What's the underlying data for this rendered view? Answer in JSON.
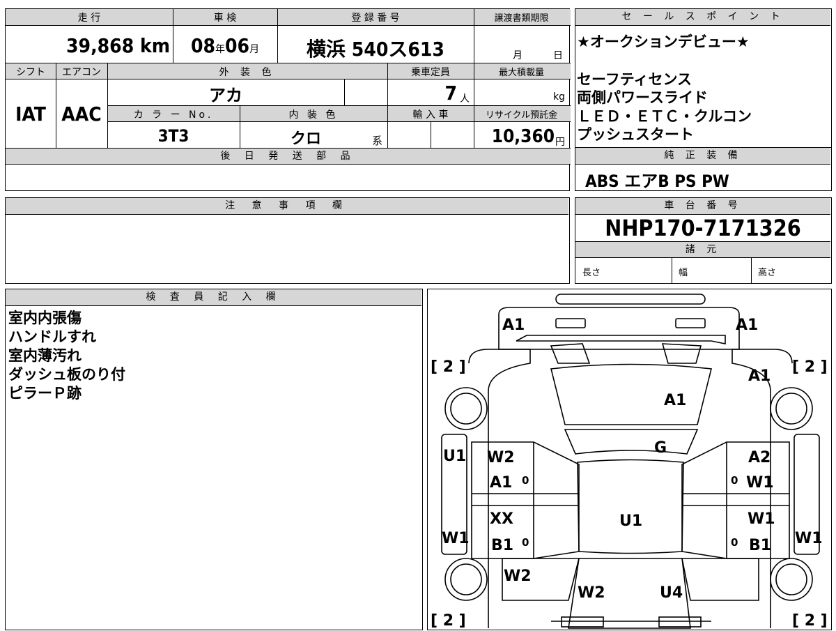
{
  "vehicle": {
    "mileage_label": "走 行",
    "mileage_value": "39,868",
    "mileage_unit": "km",
    "inspection_label": "車 検",
    "inspection_year": "08",
    "inspection_year_unit": "年",
    "inspection_month": "06",
    "inspection_month_unit": "月",
    "registration_label": "登 録 番 号",
    "registration_value": "横浜 540ス613",
    "transfer_deadline_label": "譲渡書類期限",
    "transfer_month_unit": "月",
    "transfer_day_unit": "日",
    "shift_label": "シフト",
    "shift_value": "IAT",
    "aircon_label": "エアコン",
    "aircon_value": "AAC",
    "exterior_color_label": "外 装 色",
    "exterior_color_value": "アカ",
    "capacity_label": "乗車定員",
    "capacity_value": "7",
    "capacity_unit": "人",
    "max_load_label": "最大積載量",
    "max_load_unit": "kg",
    "color_no_label": "カ ラ ー No.",
    "color_no_value": "3T3",
    "interior_color_label": "内 装 色",
    "interior_color_value": "クロ",
    "interior_color_suffix": "系",
    "import_label": "輸 入 車",
    "recycle_label": "リサイクル預託金",
    "recycle_value": "10,360",
    "recycle_unit": "円",
    "later_parts_label": "後 日 発 送 部 品"
  },
  "sales_points": {
    "header": "セ ー ル ス ポ イ ン ト",
    "lines": [
      "★オークションデビュー★",
      "",
      "セーフティセンス",
      "両側パワースライド",
      "ＬＥＤ・ＥＴＣ・クルコン",
      "プッシュスタート"
    ]
  },
  "equipment": {
    "header": "純 正 装 備",
    "value": "ABS エアB PS PW"
  },
  "notes": {
    "header": "注 意 事 項 欄"
  },
  "chassis": {
    "header": "車 台 番 号",
    "value": "NHP170-7171326",
    "specs_header": "諸 元",
    "length_label": "長さ",
    "width_label": "幅",
    "height_label": "高さ"
  },
  "inspector": {
    "header": "検 査 員 記 入 欄",
    "lines": [
      "室内内張傷",
      "ハンドルすれ",
      "室内薄汚れ",
      "ダッシュ板のり付",
      "ピラーＰ跡"
    ]
  },
  "diagram": {
    "labels": {
      "a1_top_left": "A1",
      "a1_top_right": "A1",
      "bracket_top_left": "[ 2 ]",
      "bracket_top_right": "[ 2 ]",
      "a1_right_fender": "A1",
      "a1_hood": "A1",
      "g_windshield": "G",
      "u1_left": "U1",
      "w2_front_left_door": "W2",
      "a1_front_left_door": "A1",
      "a2_front_right_door": "A2",
      "w1_front_right_door": "W1",
      "xx_rear_left_door": "XX",
      "b1_rear_left_door": "B1",
      "w1_left_sill": "W1",
      "u1_roof": "U1",
      "w1_rear_right_door": "W1",
      "b1_rear_right_door": "B1",
      "w1_right_sill": "W1",
      "w2_rear_left_quarter": "W2",
      "w2_rear_glass": "W2",
      "u4_rear": "U4",
      "bracket_bottom_left": "[ 2 ]",
      "bracket_bottom_right": "[ 2 ]",
      "zero_1": "0",
      "zero_2": "0",
      "zero_3": "0",
      "zero_4": "0"
    }
  }
}
